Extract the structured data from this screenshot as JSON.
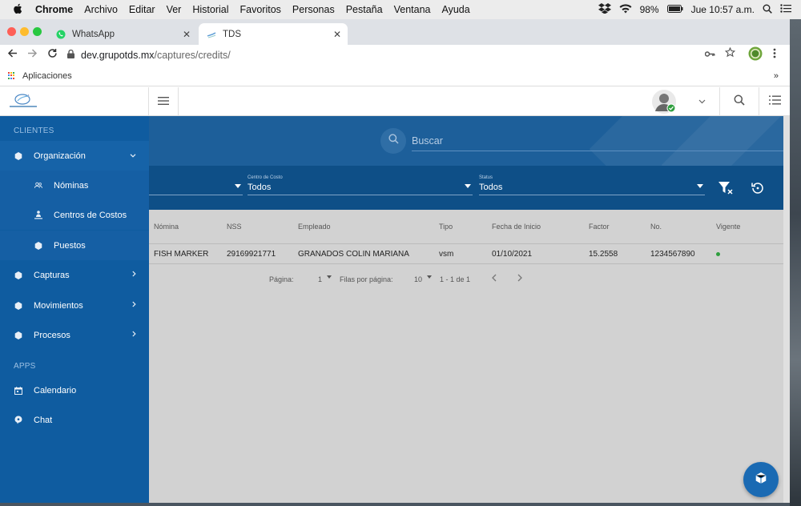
{
  "menubar": {
    "app": "Chrome",
    "items": [
      "Archivo",
      "Editar",
      "Ver",
      "Historial",
      "Favoritos",
      "Personas",
      "Pestaña",
      "Ventana",
      "Ayuda"
    ],
    "battery": "98%",
    "clock": "Jue 10:57 a.m."
  },
  "browser": {
    "tabs": [
      {
        "label": "WhatsApp",
        "active": false,
        "icon": "whatsapp-icon"
      },
      {
        "label": "TDS",
        "active": true,
        "icon": "tds-favicon"
      }
    ],
    "url_host": "dev.grupotds.mx",
    "url_path": "/captures/credits/",
    "bookmarks": {
      "apps_label": "Aplicaciones",
      "more": "»"
    }
  },
  "sidebar": {
    "section_clientes": "CLIENTES",
    "organizacion": "Organización",
    "nominas": "Nóminas",
    "centros": "Centros de Costos",
    "puestos": "Puestos",
    "capturas": "Capturas",
    "movimientos": "Movimientos",
    "procesos": "Procesos",
    "section_apps": "APPS",
    "calendario": "Calendario",
    "chat": "Chat"
  },
  "search": {
    "placeholder": "Buscar"
  },
  "filters": {
    "centro_label": "Centro de Costo",
    "centro_value": "Todos",
    "status_label": "Status",
    "status_value": "Todos"
  },
  "table": {
    "headers": {
      "nomina": "Nómina",
      "nss": "NSS",
      "empleado": "Empleado",
      "tipo": "Tipo",
      "fecha": "Fecha de Inicio",
      "factor": "Factor",
      "no": "No.",
      "vigente": "Vigente"
    },
    "rows": [
      {
        "nomina": "FISH MARKER",
        "nss": "29169921771",
        "empleado": "GRANADOS COLIN MARIANA",
        "tipo": "vsm",
        "fecha": "01/10/2021",
        "factor": "15.2558",
        "no": "1234567890",
        "vigente": true
      }
    ]
  },
  "pager": {
    "page_label": "Página:",
    "page_value": "1",
    "rows_label": "Filas por página:",
    "rows_value": "10",
    "range": "1 - 1 de 1"
  },
  "colors": {
    "sidebar": "#0f5ca0",
    "banner": "#1d5f9a",
    "filters": "#0e4f87",
    "vigente_dot": "#2e9e3e",
    "fab": "#1a6ab3"
  }
}
